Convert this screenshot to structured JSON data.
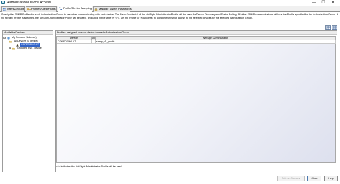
{
  "window": {
    "title": "Authorization/Device Access",
    "controls": {
      "minimize": "—",
      "maximize": "☐",
      "close": "✕"
    }
  },
  "tabs": [
    {
      "label": "Users/Groups",
      "icon": "users-icon"
    },
    {
      "label": "Profiles/Credentials",
      "icon": "key-icon"
    },
    {
      "label": "Profile/Device Mapping",
      "icon": "mapping-icon",
      "active": true
    },
    {
      "label": "Manage SNMP Passwords",
      "icon": "password-icon"
    }
  ],
  "description": "Specify the SNMP Profiles for each Authorization Group to use when communicating with each device. The Read Credential of the NetSight Administrator Profile will be used for Device Discovery and Status Polling. All other SNMP communications will use the Profile specified for the Authorization Group. If no specific Profile is specified, the NetSight Administrator Profile will be used - indicated in this table by <*>. Set the Profile to \"No Access\" to completely restrict access to the selected devices for the selected Authorization Group.",
  "toolbar": {
    "icons": [
      "table-view-icon",
      "grid-view-icon"
    ]
  },
  "left_panel": {
    "header": "Available Devices",
    "tree": [
      {
        "label": "My Network (1 device)",
        "expander": "−",
        "icon": "network-icon"
      },
      {
        "label": "All Devices (1 device)",
        "expander": "",
        "icon": "folder-icon"
      },
      {
        "label": "COREDEMO.87",
        "expander": "",
        "icon": "warning-device-icon",
        "selected": true
      },
      {
        "label": "Grouped By (1 device)",
        "expander": "+",
        "icon": "folder-icon"
      }
    ]
  },
  "right_panel": {
    "header": "Profiles assigned to each device for each Authorization Group",
    "columns": [
      "Device",
      "SU",
      "NetSight Administrator"
    ],
    "rows": [
      [
        "COREDEMO.87",
        "",
        "snmp_v1_profile"
      ]
    ],
    "footnote": "<*> indicates the NetSight Administrator Profile will be used."
  },
  "buttons": {
    "refresh": "Refresh Devices",
    "close": "Close",
    "help": "Help"
  }
}
